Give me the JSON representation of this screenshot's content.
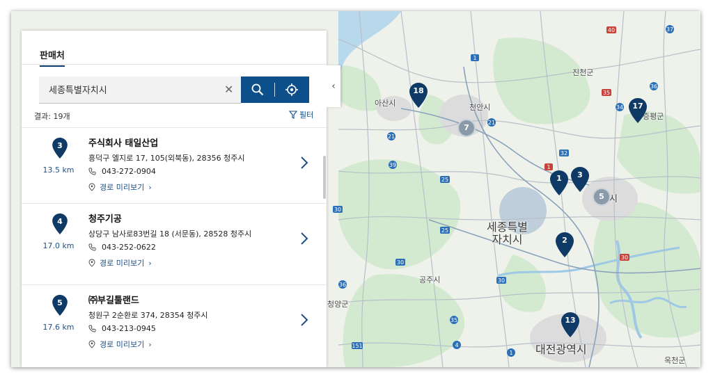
{
  "panel": {
    "tab": "판매처",
    "search_value": "세종특별자치시",
    "results_label": "결과: 19개",
    "filter_label": "필터",
    "dealers": [
      {
        "rank": "3",
        "distance": "13.5 km",
        "name": "주식회사 태일산업",
        "address": "흥덕구 엘지로 17, 105(외북동), 28356 청주시",
        "phone": "043-272-0904",
        "route": "경로 미리보기"
      },
      {
        "rank": "4",
        "distance": "17.0 km",
        "name": "청주기공",
        "address": "상당구 남사로83번길 18 (서문동), 28528 청주시",
        "phone": "043-252-0622",
        "route": "경로 미리보기"
      },
      {
        "rank": "5",
        "distance": "17.6 km",
        "name": "㈜부길툴랜드",
        "address": "청원구 2순환로 374, 28354 청주시",
        "phone": "043-213-0945",
        "route": "경로 미리보기"
      }
    ]
  },
  "map": {
    "places": [
      "아산시",
      "천안시",
      "진천군",
      "증평군",
      "세종특별\n자치시",
      "대전광역시",
      "공주시",
      "청양군",
      "옥천군",
      "시"
    ],
    "road_numbers": [
      "40",
      "37",
      "1",
      "35",
      "34",
      "21",
      "39",
      "32",
      "1",
      "25",
      "30",
      "25",
      "30",
      "30",
      "36",
      "151",
      "4",
      "1",
      "35",
      "30",
      "36"
    ],
    "markers": [
      "18",
      "17",
      "1",
      "3",
      "2",
      "13"
    ],
    "clusters": [
      "7",
      "5"
    ],
    "colors": {
      "marker": "#0f3a66",
      "cluster": "#8a9aa8",
      "button": "#0c4f8a",
      "link": "#1d4f86"
    }
  }
}
